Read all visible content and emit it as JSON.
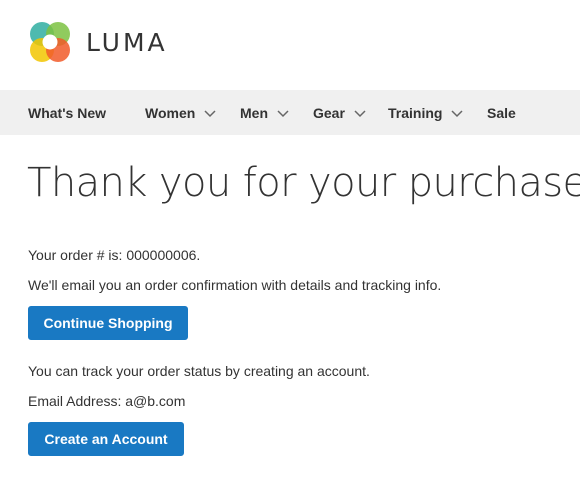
{
  "header": {
    "logo_text": "LUMA"
  },
  "nav": {
    "items": [
      {
        "label": "What's New",
        "has_dropdown": false
      },
      {
        "label": "Women",
        "has_dropdown": true
      },
      {
        "label": "Men",
        "has_dropdown": true
      },
      {
        "label": "Gear",
        "has_dropdown": true
      },
      {
        "label": "Training",
        "has_dropdown": true
      },
      {
        "label": "Sale",
        "has_dropdown": false
      }
    ]
  },
  "main": {
    "title": "Thank you for your purchase!",
    "order_line": "Your order # is: 000000006.",
    "email_line": "We'll email you an order confirmation with details and tracking info.",
    "continue_button": "Continue Shopping",
    "track_line": "You can track your order status by creating an account.",
    "email_address_line": "Email Address: a@b.com",
    "create_account_button": "Create an Account"
  },
  "colors": {
    "button_bg": "#1979c3",
    "nav_bg": "#f0f0f0",
    "text": "#333333"
  }
}
